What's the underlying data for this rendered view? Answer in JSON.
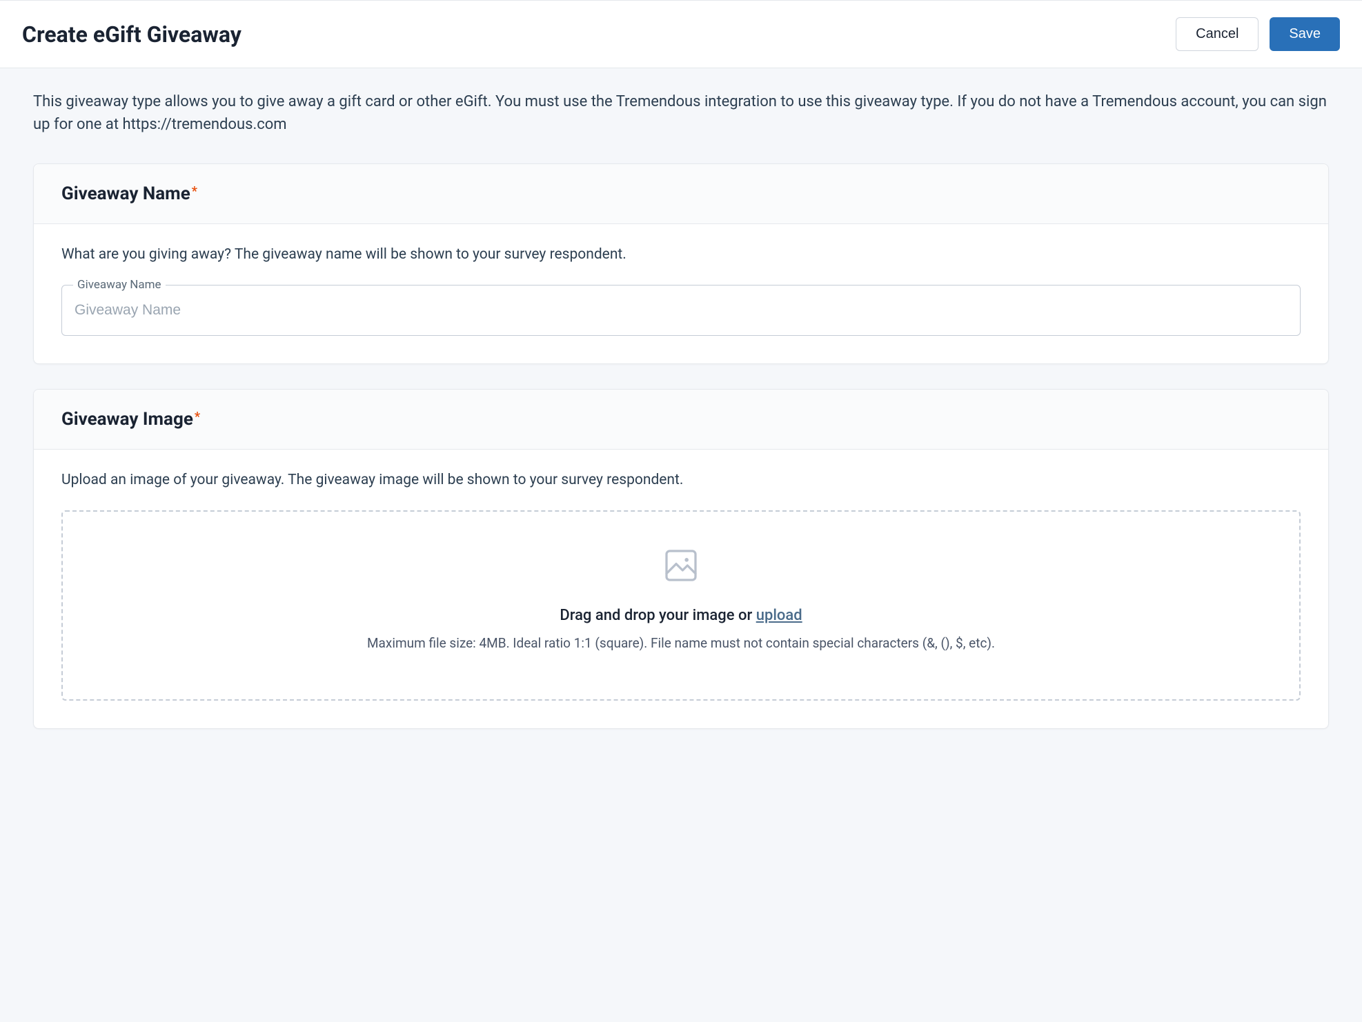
{
  "header": {
    "title": "Create eGift Giveaway",
    "cancel_label": "Cancel",
    "save_label": "Save"
  },
  "description": "This giveaway type allows you to give away a gift card or other eGift. You must use the Tremendous integration to use this giveaway type. If you do not have a Tremendous account, you can sign up for one at https://tremendous.com",
  "sections": {
    "name": {
      "title": "Giveaway Name",
      "required_mark": "*",
      "description": "What are you giving away? The giveaway name will be shown to your survey respondent.",
      "input_label": "Giveaway Name",
      "input_placeholder": "Giveaway Name",
      "input_value": ""
    },
    "image": {
      "title": "Giveaway Image",
      "required_mark": "*",
      "description": "Upload an image of your giveaway. The giveaway image will be shown to your survey respondent.",
      "dropzone_prefix": "Drag and drop your image or ",
      "upload_link_text": "upload",
      "hint": "Maximum file size: 4MB. Ideal ratio 1:1 (square). File name must not contain special characters (&, (), $, etc)."
    }
  }
}
